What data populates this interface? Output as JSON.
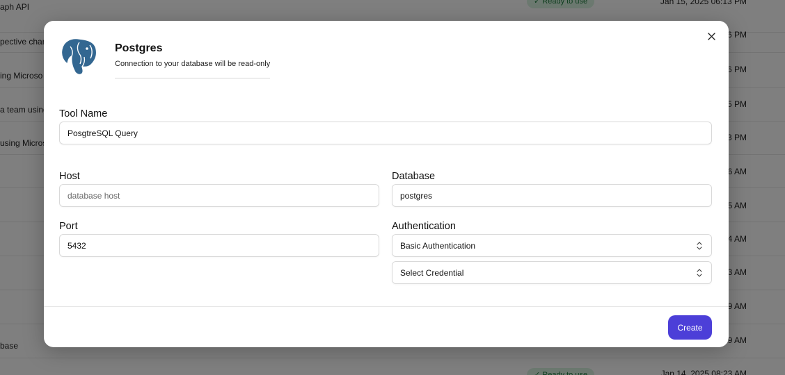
{
  "background": {
    "rows": [
      {
        "name": "aph API",
        "time": "Jan 15, 2025 06:13 PM",
        "badge": "✓ Ready to use"
      },
      {
        "name": "pective chan",
        "time": "6 PM",
        "badge": ""
      },
      {
        "name": "ing Microso",
        "time": "6 PM",
        "badge": ""
      },
      {
        "name": "a team using",
        "time": "5 PM",
        "badge": ""
      },
      {
        "name": "using Micros",
        "time": "3 PM",
        "badge": ""
      },
      {
        "name": "",
        "time": "6 AM",
        "badge": ""
      },
      {
        "name": "",
        "time": "5 AM",
        "badge": ""
      },
      {
        "name": "",
        "time": "4 AM",
        "badge": ""
      },
      {
        "name": "",
        "time": "3 AM",
        "badge": ""
      },
      {
        "name": "",
        "time": "9 AM",
        "badge": ""
      },
      {
        "name": "base",
        "time": "9 AM",
        "badge": ""
      },
      {
        "name": "",
        "time": "Jan 14, 2025 08:23 AM",
        "badge": "✓ Ready to use"
      }
    ]
  },
  "modal": {
    "title": "Postgres",
    "subtitle": "Connection to your database will be read-only",
    "logo_icon": "postgres-elephant-icon",
    "close_icon": "close-icon",
    "tool_name": {
      "label": "Tool Name",
      "value": "PosgtreSQL Query"
    },
    "host": {
      "label": "Host",
      "value": "",
      "placeholder": "database host"
    },
    "database": {
      "label": "Database",
      "value": "postgres"
    },
    "port": {
      "label": "Port",
      "value": "5432"
    },
    "authentication": {
      "label": "Authentication",
      "selected": "Basic Authentication"
    },
    "credential": {
      "selected": "Select Credential"
    },
    "create_label": "Create"
  },
  "colors": {
    "accent": "#4c3fd8",
    "logo_blue": "#336791"
  }
}
